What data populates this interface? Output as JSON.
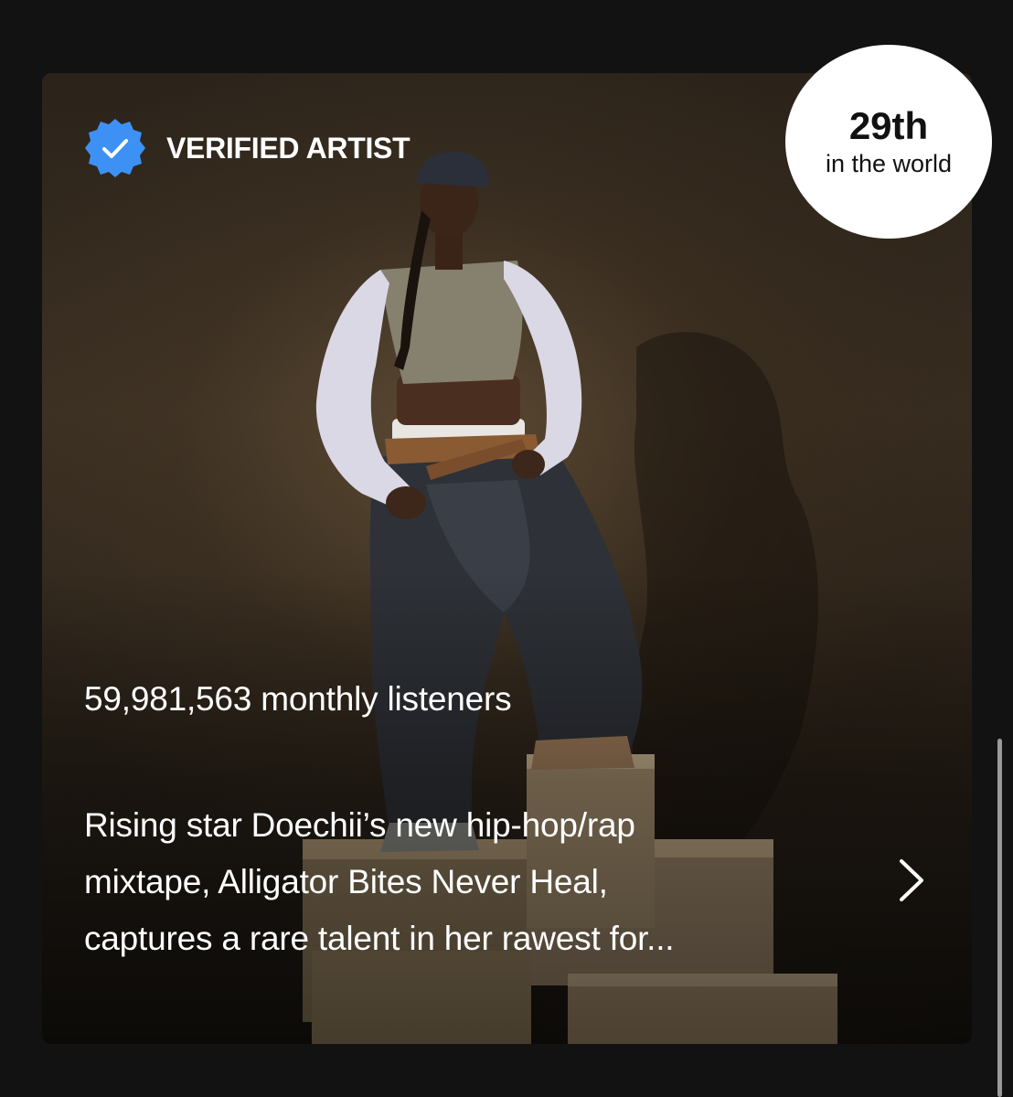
{
  "about": {
    "verified_label": "VERIFIED ARTIST",
    "monthly_listeners": "59,981,563 monthly listeners",
    "bio_lines": [
      "Rising star Doechii’s new hip-hop/rap",
      "mixtape, Alligator Bites Never Heal,",
      "captures a rare talent in her rawest for..."
    ],
    "rank": {
      "value": "29th",
      "caption": "in the world"
    }
  },
  "icons": {
    "verified": "verified-badge-icon",
    "chevron": "chevron-right-icon"
  },
  "colors": {
    "background": "#121212",
    "verified_blue": "#3d91f4",
    "rank_circle": "#ffffff",
    "text": "#ffffff"
  }
}
